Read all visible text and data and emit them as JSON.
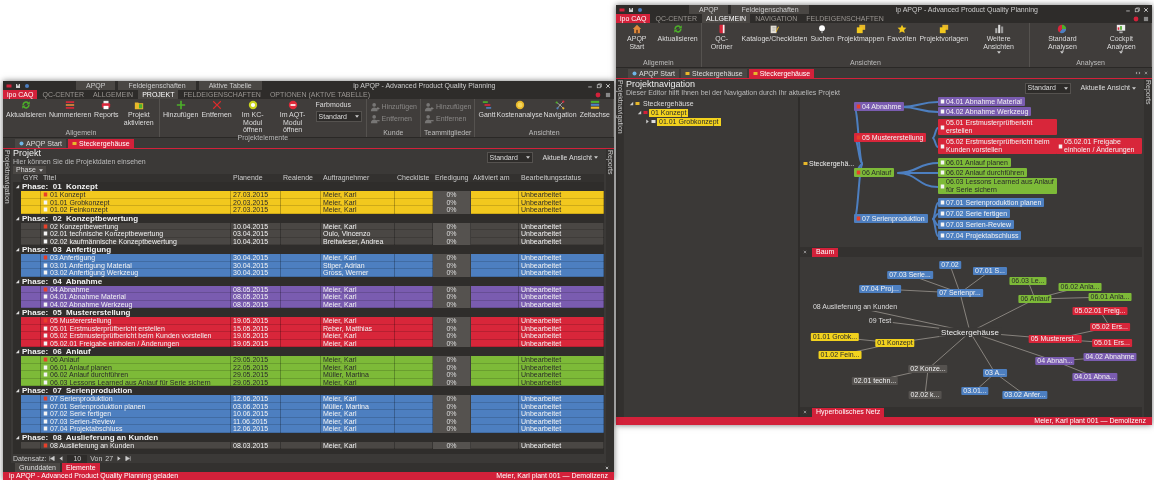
{
  "back_window": {
    "title": "ip APQP - Advanced Product Quality Planning",
    "context_tabs": [
      "APQP",
      "Feldeigenschaften"
    ],
    "menu_tabs": [
      {
        "label": "ipo CAQ",
        "kind": "app",
        "selected": false
      },
      {
        "label": "QC-CENTER",
        "kind": "tab",
        "selected": false
      },
      {
        "label": "ALLGEMEIN",
        "kind": "tab",
        "selected": true
      },
      {
        "label": "NAVIGATION",
        "kind": "tab",
        "selected": false
      },
      {
        "label": "FELDEIGENSCHAFTEN",
        "kind": "tab",
        "selected": false
      }
    ],
    "ribbon": [
      {
        "label": "Allgemein",
        "buttons": [
          {
            "label": "APQP Start",
            "has_menu": false
          },
          {
            "label": "Aktualisieren",
            "has_menu": false
          }
        ]
      },
      {
        "label": "Ansichten",
        "buttons": [
          {
            "label": "QC-Ordner",
            "has_menu": false
          },
          {
            "label": "Kataloge/Checklisten",
            "has_menu": false
          },
          {
            "label": "Suchen",
            "has_menu": false
          },
          {
            "label": "Projektmappen",
            "has_menu": false
          },
          {
            "label": "Favoriten",
            "has_menu": false
          },
          {
            "label": "Projektvorlagen",
            "has_menu": false
          },
          {
            "label": "Weitere Ansichten",
            "has_menu": true
          }
        ]
      },
      {
        "label": "Analysen",
        "buttons": [
          {
            "label": "Standard Analysen",
            "has_menu": true
          },
          {
            "label": "Cockpit Analysen",
            "has_menu": true
          }
        ]
      }
    ],
    "doc_tabs": [
      {
        "label": "APQP Start",
        "selected": false
      },
      {
        "label": "Steckergehäuse",
        "selected": false
      },
      {
        "label": "Steckergehäuse",
        "selected": true
      }
    ],
    "left_strip": "Projektnavigation",
    "right_strip": "Reports",
    "heading": "Projektnavigation",
    "subtitle": "Dieser Editor hilft Ihnen bei der Navigation durch Ihr aktuelles Projekt",
    "view_select": "Standard",
    "view_menu": "Aktuelle Ansicht",
    "tree": [
      {
        "label": "Steckergehäuse",
        "expanded": true,
        "children": [
          {
            "label": "01 Konzept",
            "color": "#f2d21e",
            "expanded": true,
            "children": [
              {
                "label": "01.01 Grobkonzept",
                "color": "#f2d21e",
                "expanded": false
              }
            ]
          }
        ]
      }
    ],
    "mind_map": {
      "root": "Steckergehä...",
      "branches": [
        {
          "label": "04 Abnahme",
          "color": "#7a5cb0",
          "children": [
            {
              "label": "04.01 Abnahme Material"
            },
            {
              "label": "04.02 Abnahme Werkzeug"
            }
          ]
        },
        {
          "label": "05 Mustererstellung",
          "color": "#d8263a",
          "children": [
            {
              "label": "05.01 Erstmusterprüfbericht erstellen"
            },
            {
              "label": "05.02 Erstmusterprüfbericht beim Kunden vorstellen",
              "children": [
                {
                  "label": "05.02.01 Freigabe einholen / Änderungen"
                }
              ]
            }
          ]
        },
        {
          "label": "06 Anlauf",
          "color": "#7dba38",
          "children": [
            {
              "label": "06.01 Anlauf planen"
            },
            {
              "label": "06.02 Anlauf durchführen"
            },
            {
              "label": "06.03 Lessons Learned aus Anlauf für Serie sichern"
            }
          ]
        },
        {
          "label": "07 Serienproduktion",
          "color": "#4d7fc0",
          "children": [
            {
              "label": "07.01 Serienproduktion planen"
            },
            {
              "label": "07.02 Serie fertigen"
            },
            {
              "label": "07.03 Serien-Review"
            },
            {
              "label": "07.04 Projektabschluss"
            }
          ]
        }
      ]
    },
    "tree_tab": {
      "label": "Baum",
      "selected": true
    },
    "network": {
      "root": "Steckergehäuse",
      "branches": [
        {
          "label": "07 Serienpr...",
          "color": "#4d7fc0",
          "children": [
            {
              "label": "07.02"
            },
            {
              "label": "07.01 S..."
            },
            {
              "label": "07.03 Serie..."
            },
            {
              "label": "07.04 Proj..."
            }
          ]
        },
        {
          "label": "06 Anlauf",
          "color": "#7dba38",
          "children": [
            {
              "label": "06.03 Le..."
            },
            {
              "label": "06.02 Anla..."
            },
            {
              "label": "06.01 Anla..."
            }
          ]
        },
        {
          "label": "08 Auslieferung an Kunden"
        },
        {
          "label": "09 Test"
        },
        {
          "label": "05 Mustererst...",
          "color": "#d8263a",
          "children": [
            {
              "label": "05.02 Ers...",
              "children": [
                {
                  "label": "05.02.01 Freig..."
                }
              ]
            },
            {
              "label": "05.01 Ers..."
            }
          ]
        },
        {
          "label": "01 Konzept",
          "color": "#f2d21e",
          "children": [
            {
              "label": "01.01 Grobk..."
            },
            {
              "label": "01.02 Fein..."
            }
          ]
        },
        {
          "label": "04 Abnah...",
          "color": "#7a5cb0",
          "children": [
            {
              "label": "04.02 Abnahme"
            },
            {
              "label": "04.01 Abna..."
            }
          ]
        },
        {
          "label": "02 Konze...",
          "color": "#55524f",
          "children": [
            {
              "label": "02.01 techn..."
            },
            {
              "label": "02.02 k..."
            }
          ]
        },
        {
          "label": "03 A...",
          "color": "#4d7fc0",
          "children": [
            {
              "label": "03.01..."
            },
            {
              "label": "03.02 Anfer..."
            }
          ]
        }
      ]
    },
    "network_tab": {
      "label": "Hyperbolisches Netz",
      "selected": true
    },
    "status": "Meier, Karl  plant 001  —  Demolizenz"
  },
  "front_window": {
    "title": "ip APQP - Advanced Product Quality Planning",
    "context_tabs": [
      "APQP",
      "Feldeigenschaften",
      "Aktive Tabelle"
    ],
    "menu_tabs": [
      {
        "label": "ipo CAQ",
        "kind": "app",
        "selected": false
      },
      {
        "label": "QC-CENTER",
        "kind": "tab",
        "selected": false
      },
      {
        "label": "ALLGEMEIN",
        "kind": "tab",
        "selected": false
      },
      {
        "label": "PROJEKT",
        "kind": "tab",
        "selected": true
      },
      {
        "label": "FELDEIGENSCHAFTEN",
        "kind": "tab",
        "selected": false
      },
      {
        "label": "OPTIONEN (AKTIVE TABELLE)",
        "kind": "tab",
        "selected": false
      }
    ],
    "ribbon": [
      {
        "label": "Allgemein",
        "buttons": [
          {
            "label": "Aktualisieren",
            "disabled": false
          },
          {
            "label": "Nummerieren",
            "disabled": false
          },
          {
            "label": "Reports",
            "disabled": false
          },
          {
            "label": "Projekt aktivieren",
            "disabled": false
          }
        ]
      },
      {
        "label": "Projektelemente",
        "buttons": [
          {
            "label": "Hinzufügen",
            "disabled": false
          },
          {
            "label": "Entfernen",
            "disabled": false
          },
          {
            "label": "Im KC-Modul öffnen",
            "disabled": false
          },
          {
            "label": "Im AQT-Modul öffnen",
            "disabled": false
          }
        ],
        "dropdown": {
          "label": "Farbmodus",
          "value": "Standard"
        }
      },
      {
        "label": "Kunde",
        "buttons": [
          {
            "label": "Hinzufügen",
            "disabled": true
          },
          {
            "label": "Entfernen",
            "disabled": true
          }
        ]
      },
      {
        "label": "Teammitglieder",
        "buttons": [
          {
            "label": "Hinzufügen",
            "disabled": true
          },
          {
            "label": "Entfernen",
            "disabled": true
          }
        ]
      },
      {
        "label": "Ansichten",
        "buttons": [
          {
            "label": "Gantt",
            "disabled": false
          },
          {
            "label": "Kostenanalyse",
            "disabled": false
          },
          {
            "label": "Navigation",
            "disabled": false
          },
          {
            "label": "Zeitachse",
            "disabled": false
          }
        ]
      }
    ],
    "doc_tabs": [
      {
        "label": "APQP Start",
        "selected": false
      },
      {
        "label": "Steckergehäuse",
        "selected": true
      }
    ],
    "left_strip": "Projektnavigation",
    "right_strip": "Reports",
    "heading": "Projekt",
    "subtitle": "Hier können Sie die Projektdaten einsehen",
    "view_select": "Standard",
    "view_menu": "Aktuelle Ansicht",
    "group_by": "Phase",
    "columns": [
      "GYR",
      "Titel",
      "Planende",
      "Realende",
      "Auftragnehmer",
      "Checkliste",
      "Erledigung",
      "Aktiviert am",
      "Bearbeitungsstatus"
    ],
    "phases": [
      {
        "title": "Phase:  01  Konzept",
        "color": "#f2c81e",
        "expanded": true,
        "rows": [
          {
            "kind": "phase",
            "title": "01 Konzept",
            "plan_end": "27.03.2015",
            "assignee": "Meier, Karl",
            "progress": "0%",
            "status": "Unbearbeitet"
          },
          {
            "kind": "task",
            "title": "01.01 Grobkonzept",
            "plan_end": "20.03.2015",
            "assignee": "Meier, Karl",
            "progress": "0%",
            "status": "Unbearbeitet"
          },
          {
            "kind": "task",
            "title": "01.02 Feinkonzept",
            "plan_end": "27.03.2015",
            "assignee": "Meier, Karl",
            "progress": "0%",
            "status": "Unbearbeitet"
          }
        ]
      },
      {
        "title": "Phase:  02  Konzeptbewertung",
        "color": "#4a4744",
        "expanded": true,
        "rows": [
          {
            "kind": "phase",
            "title": "02 Konzeptbewertung",
            "plan_end": "10.04.2015",
            "assignee": "Meier, Karl",
            "progress": "0%",
            "status": "Unbearbeitet"
          },
          {
            "kind": "task",
            "title": "02.01 technische Konzeptbewertung",
            "plan_end": "03.04.2015",
            "assignee": "Oulo, Vincenzo",
            "progress": "0%",
            "status": "Unbearbeitet"
          },
          {
            "kind": "task",
            "title": "02.02 kaufmännische Konzeptbewertung",
            "plan_end": "10.04.2015",
            "assignee": "Breitwieser, Andrea",
            "progress": "0%",
            "status": "Unbearbeitet"
          }
        ]
      },
      {
        "title": "Phase:  03  Anfertigung",
        "color": "#4d7fc0",
        "expanded": true,
        "rows": [
          {
            "kind": "phase",
            "title": "03 Anfertigung",
            "plan_end": "30.04.2015",
            "assignee": "Meier, Karl",
            "progress": "0%",
            "status": "Unbearbeitet"
          },
          {
            "kind": "task",
            "title": "03.01 Anfertigung Material",
            "plan_end": "30.04.2015",
            "assignee": "Stiper, Adrian",
            "progress": "0%",
            "status": "Unbearbeitet"
          },
          {
            "kind": "task",
            "title": "03.02 Anfertigung Werkzeug",
            "plan_end": "30.04.2015",
            "assignee": "Gross, Werner",
            "progress": "0%",
            "status": "Unbearbeitet"
          }
        ]
      },
      {
        "title": "Phase:  04  Abnahme",
        "color": "#7a5cb0",
        "expanded": true,
        "rows": [
          {
            "kind": "phase",
            "title": "04 Abnahme",
            "plan_end": "08.05.2015",
            "assignee": "Meier, Karl",
            "progress": "0%",
            "status": "Unbearbeitet"
          },
          {
            "kind": "task",
            "title": "04.01 Abnahme Material",
            "plan_end": "08.05.2015",
            "assignee": "Meier, Karl",
            "progress": "0%",
            "status": "Unbearbeitet"
          },
          {
            "kind": "task",
            "title": "04.02 Abnahme Werkzeug",
            "plan_end": "08.05.2015",
            "assignee": "Meier, Karl",
            "progress": "0%",
            "status": "Unbearbeitet"
          }
        ]
      },
      {
        "title": "Phase:  05  Mustererstellung",
        "color": "#d8263a",
        "expanded": true,
        "rows": [
          {
            "kind": "phase",
            "title": "05 Mustererstellung",
            "plan_end": "19.05.2015",
            "assignee": "Meier, Karl",
            "progress": "0%",
            "status": "Unbearbeitet"
          },
          {
            "kind": "task",
            "title": "05.01 Erstmusterprüfbericht erstellen",
            "plan_end": "15.05.2015",
            "assignee": "Reber, Matthias",
            "progress": "0%",
            "status": "Unbearbeitet"
          },
          {
            "kind": "task",
            "title": "05.02 Erstmusterprüfbericht beim Kunden vorstellen",
            "plan_end": "19.05.2015",
            "assignee": "Meier, Karl",
            "progress": "0%",
            "status": "Unbearbeitet"
          },
          {
            "kind": "task",
            "title": "05.02.01 Freigabe einholen / Änderungen",
            "plan_end": "19.05.2015",
            "assignee": "Meier, Karl",
            "progress": "0%",
            "status": "Unbearbeitet"
          }
        ]
      },
      {
        "title": "Phase:  06  Anlauf",
        "color": "#7dba38",
        "expanded": true,
        "rows": [
          {
            "kind": "phase",
            "title": "06 Anlauf",
            "plan_end": "29.05.2015",
            "assignee": "Meier, Karl",
            "progress": "0%",
            "status": "Unbearbeitet"
          },
          {
            "kind": "task",
            "title": "06.01 Anlauf planen",
            "plan_end": "22.05.2015",
            "assignee": "Meier, Karl",
            "progress": "0%",
            "status": "Unbearbeitet"
          },
          {
            "kind": "task",
            "title": "06.02 Anlauf durchführen",
            "plan_end": "29.05.2015",
            "assignee": "Müller, Martina",
            "progress": "0%",
            "status": "Unbearbeitet"
          },
          {
            "kind": "task",
            "title": "06.03 Lessons Learned aus Anlauf für Serie sichern",
            "plan_end": "29.05.2015",
            "assignee": "Meier, Karl",
            "progress": "0%",
            "status": "Unbearbeitet"
          }
        ]
      },
      {
        "title": "Phase:  07  Serienproduktion",
        "color": "#4d7fc0",
        "expanded": true,
        "rows": [
          {
            "kind": "phase",
            "title": "07 Serienproduktion",
            "plan_end": "12.06.2015",
            "assignee": "Meier, Karl",
            "progress": "0%",
            "status": "Unbearbeitet"
          },
          {
            "kind": "task",
            "title": "07.01 Serienproduktion planen",
            "plan_end": "03.06.2015",
            "assignee": "Müller, Martina",
            "progress": "0%",
            "status": "Unbearbeitet"
          },
          {
            "kind": "task",
            "title": "07.02 Serie fertigen",
            "plan_end": "10.06.2015",
            "assignee": "Meier, Karl",
            "progress": "0%",
            "status": "Unbearbeitet"
          },
          {
            "kind": "task",
            "title": "07.03 Serien-Review",
            "plan_end": "11.06.2015",
            "assignee": "Meier, Karl",
            "progress": "0%",
            "status": "Unbearbeitet"
          },
          {
            "kind": "task",
            "title": "07.04 Projektabschluss",
            "plan_end": "12.06.2015",
            "assignee": "Meier, Karl",
            "progress": "0%",
            "status": "Unbearbeitet"
          }
        ]
      },
      {
        "title": "Phase:  08  Auslieferung an Kunden",
        "color": "#4a4744",
        "expanded": true,
        "rows": [
          {
            "kind": "phase",
            "title": "08 Auslieferung an Kunden",
            "plan_end": "08.03.2015",
            "assignee": "Meier, Karl",
            "progress": "0%",
            "status": "Unbearbeitet"
          }
        ]
      }
    ],
    "navigator": {
      "label": "Datensatz:",
      "current": "10",
      "of": "Von",
      "total": "27"
    },
    "bottom_tabs": [
      {
        "label": "Grunddaten",
        "selected": false
      },
      {
        "label": "Elemente",
        "selected": true
      }
    ],
    "status_left": "ip APQP - Advanced Product Quality Planning geladen",
    "status_right": "Meier, Karl  plant 001  —  Demolizenz"
  }
}
